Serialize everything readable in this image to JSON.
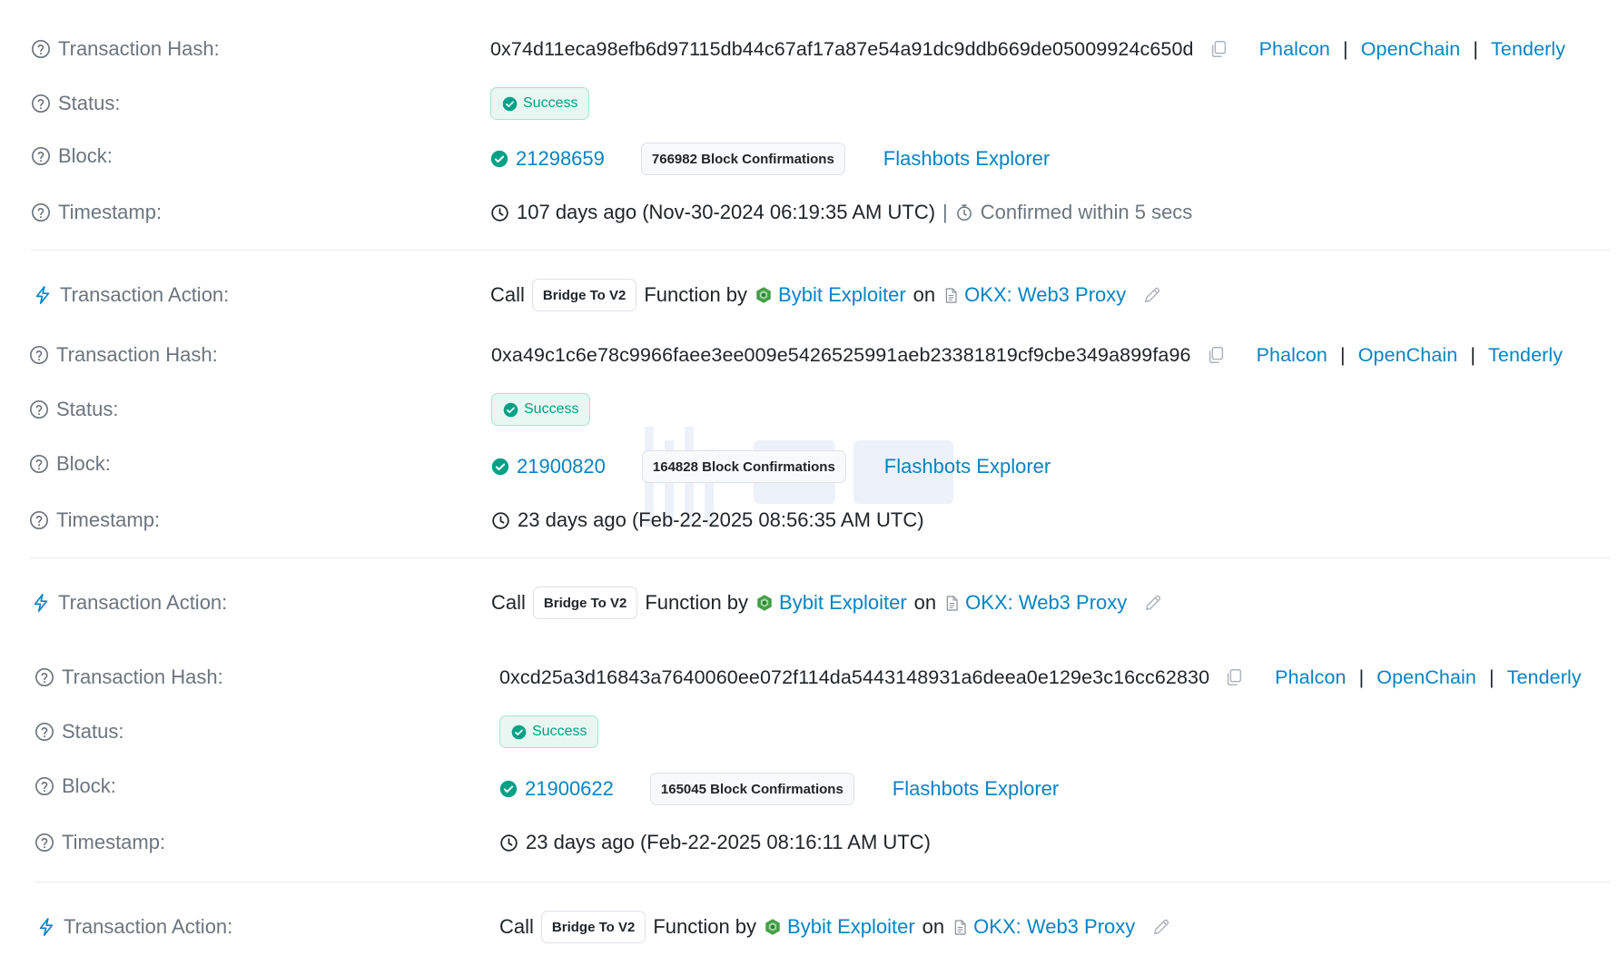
{
  "colors": {
    "link": "#0784c3",
    "success": "#00a186",
    "label": "#6c757d",
    "text": "#212529"
  },
  "transactions": [
    {
      "labels": {
        "hash": "Transaction Hash:",
        "status": "Status:",
        "block": "Block:",
        "timestamp": "Timestamp:",
        "action": "Transaction Action:"
      },
      "hash": "0x74d11eca98efb6d97115db44c67af17a87e54a91dc9ddb669de05009924c650d",
      "links": [
        "Phalcon",
        "OpenChain",
        "Tenderly"
      ],
      "status": "Success",
      "block": "21298659",
      "confirmations": "766982 Block Confirmations",
      "explorer": "Flashbots Explorer",
      "timestamp": "107 days ago (Nov-30-2024 06:19:35 AM UTC)",
      "confirmed_within": "Confirmed within 5 secs",
      "action": {
        "call": "Call",
        "method": "Bridge To V2",
        "function_by": "Function by",
        "from": "Bybit Exploiter",
        "on": "on",
        "to": "OKX: Web3 Proxy"
      }
    },
    {
      "labels": {
        "hash": "Transaction Hash:",
        "status": "Status:",
        "block": "Block:",
        "timestamp": "Timestamp:",
        "action": "Transaction Action:"
      },
      "hash": "0xa49c1c6e78c9966faee3ee009e5426525991aeb23381819cf9cbe349a899fa96",
      "links": [
        "Phalcon",
        "OpenChain",
        "Tenderly"
      ],
      "status": "Success",
      "block": "21900820",
      "confirmations": "164828 Block Confirmations",
      "explorer": "Flashbots Explorer",
      "timestamp": "23 days ago (Feb-22-2025 08:56:35 AM UTC)",
      "action": {
        "call": "Call",
        "method": "Bridge To V2",
        "function_by": "Function by",
        "from": "Bybit Exploiter",
        "on": "on",
        "to": "OKX: Web3 Proxy"
      }
    },
    {
      "labels": {
        "hash": "Transaction Hash:",
        "status": "Status:",
        "block": "Block:",
        "timestamp": "Timestamp:",
        "action": "Transaction Action:"
      },
      "hash": "0xcd25a3d16843a7640060ee072f114da5443148931a6deea0e129e3c16cc62830",
      "links": [
        "Phalcon",
        "OpenChain",
        "Tenderly"
      ],
      "status": "Success",
      "block": "21900622",
      "confirmations": "165045 Block Confirmations",
      "explorer": "Flashbots Explorer",
      "timestamp": "23 days ago (Feb-22-2025 08:16:11 AM UTC)",
      "action": {
        "call": "Call",
        "method": "Bridge To V2",
        "function_by": "Function by",
        "from": "Bybit Exploiter",
        "on": "on",
        "to": "OKX: Web3 Proxy"
      }
    }
  ],
  "icons": {
    "help": "question-circle-icon",
    "copy": "copy-icon",
    "check": "check-circle-icon",
    "clock": "clock-icon",
    "stopwatch": "stopwatch-icon",
    "bolt": "lightning-icon",
    "contract": "contract-file-icon",
    "exploiter": "hexagon-logo-icon",
    "edit": "pencil-icon"
  }
}
